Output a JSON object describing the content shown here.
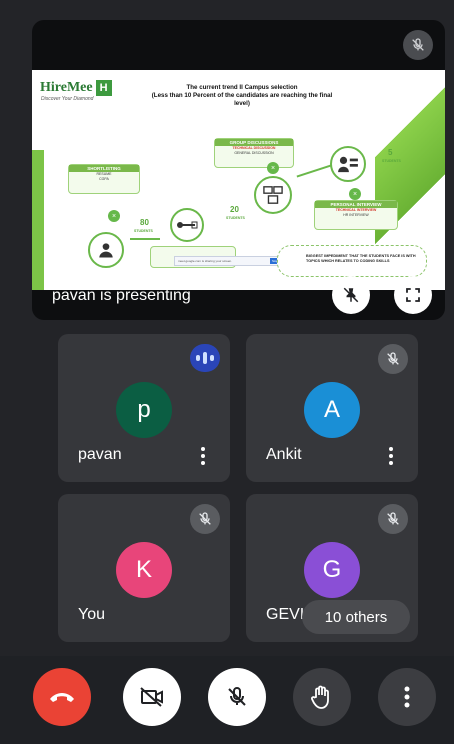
{
  "colors": {
    "background": "#232428",
    "tile": "#36373b",
    "end_call": "#ea4335",
    "avatar_p": "#0b5e43",
    "avatar_a": "#1a8fd6",
    "avatar_k": "#e8457a",
    "avatar_g": "#8a4fd6"
  },
  "presentation": {
    "presenter_label": "pavan is presenting",
    "slide": {
      "logo_text": "HireMee",
      "logo_letter": "H",
      "logo_tagline": "Discover Your Diamond",
      "title_line1": "The current trend II Campus selection",
      "title_line2": "(Less than 10 Percent of the candidates are reaching the final",
      "title_line3": "level)",
      "shortlisting": {
        "head": "SHORTLISTING",
        "line1": "RESUME",
        "line2": "CGPA"
      },
      "aptitude": {
        "head": "APTITUDE TEST",
        "line1": "CODING TEST"
      },
      "group_discussions": {
        "head": "GROUP DISCUSSIONS",
        "line1": "TECHNICAL DISCUSSION",
        "line2": "GENERAL DISCUSSION"
      },
      "personal_interview": {
        "head": "PERSONAL INTERVIEW",
        "line1": "TECHNICAL INTERVIEW",
        "line2": "HR INTERVIEW"
      },
      "count_80": "80",
      "count_20": "20",
      "count_5": "5",
      "students": "STUDENTS",
      "share_text": "meet.google.com is sharing your screen.",
      "share_stop": "Stop sharing",
      "share_hide": "Hide",
      "impediment_text": "BIGGEST IMPEDIMENT THAT THE STUDENTS FACE IS WITH TOPICS WHICH RELATES TO CODING SKILLS"
    }
  },
  "participants": [
    {
      "initial": "p",
      "name": "pavan",
      "speaking": true
    },
    {
      "initial": "A",
      "name": "Ankit",
      "muted": true
    },
    {
      "initial": "K",
      "name": "You",
      "muted": true
    },
    {
      "initial": "G",
      "name": "GEVINDASAPI",
      "muted": true
    }
  ],
  "others_label": "10 others",
  "controls": [
    {
      "icon": "end-call-icon"
    },
    {
      "icon": "camera-off-icon"
    },
    {
      "icon": "mic-off-icon"
    },
    {
      "icon": "raise-hand-icon"
    },
    {
      "icon": "more-options-icon"
    }
  ]
}
